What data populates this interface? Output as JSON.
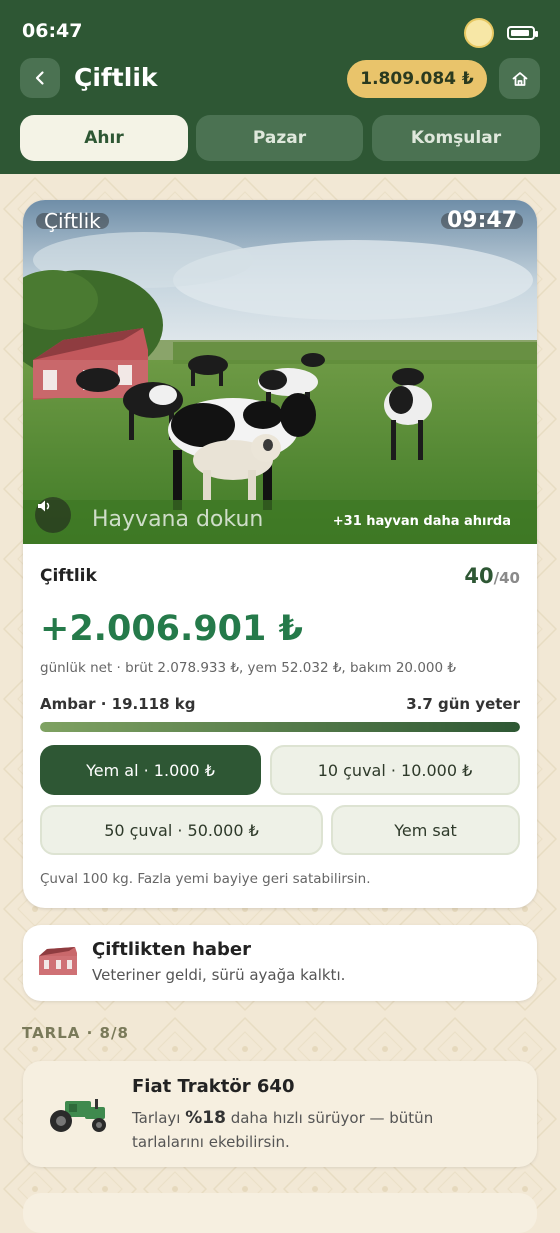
{
  "status_bar": {
    "time": "06:47"
  },
  "header": {
    "title": "Çiftlik",
    "balance": "1.809.084 ₺",
    "tabs": [
      {
        "label": "Ahır",
        "active": true
      },
      {
        "label": "Pazar",
        "active": false
      },
      {
        "label": "Komşular",
        "active": false
      }
    ]
  },
  "farm_card": {
    "photo_label": "Çiftlik",
    "photo_time": "09:47",
    "touch_hint": "Hayvana dokun",
    "more_animals": "+31 hayvan daha ahırda",
    "name": "Çiftlik",
    "capacity_current": "40",
    "capacity_max": "/40",
    "net_value": "+2.006.901 ₺",
    "net_detail": "günlük net · brüt 2.078.933 ₺, yem 52.032 ₺, bakım 20.000 ₺",
    "storage_label": "Ambar · 19.118 kg",
    "storage_days": "3.7 gün yeter",
    "storage_level": 1.0,
    "buttons": {
      "buy_feed": "Yem al · 1.000 ₺",
      "buy_10": "10 çuval · 10.000 ₺",
      "buy_50": "50 çuval · 50.000 ₺",
      "sell_feed": "Yem sat"
    },
    "note": "Çuval 100 kg. Fazla yemi bayiye geri satabilirsin."
  },
  "news": {
    "title": "Çiftlikten haber",
    "body": "Veteriner geldi, sürü ayağa kalktı."
  },
  "field_section": {
    "label": "TARLA · 8/8"
  },
  "tractor": {
    "title": "Fiat Traktör 640",
    "desc_prefix": "Tarlayı ",
    "desc_percent": "%18",
    "desc_suffix": " daha hızlı sürüyor — bütün tarlalarını ekebilirsin."
  },
  "colors": {
    "header_bg": "#2e5734",
    "accent_gold": "#e9c46b",
    "net_green": "#257a4a",
    "page_bg": "#f2e8d5"
  },
  "icons": [
    "back-icon",
    "home-icon",
    "sound-icon",
    "barn-icon",
    "tractor-icon",
    "sun-icon",
    "battery-icon"
  ]
}
